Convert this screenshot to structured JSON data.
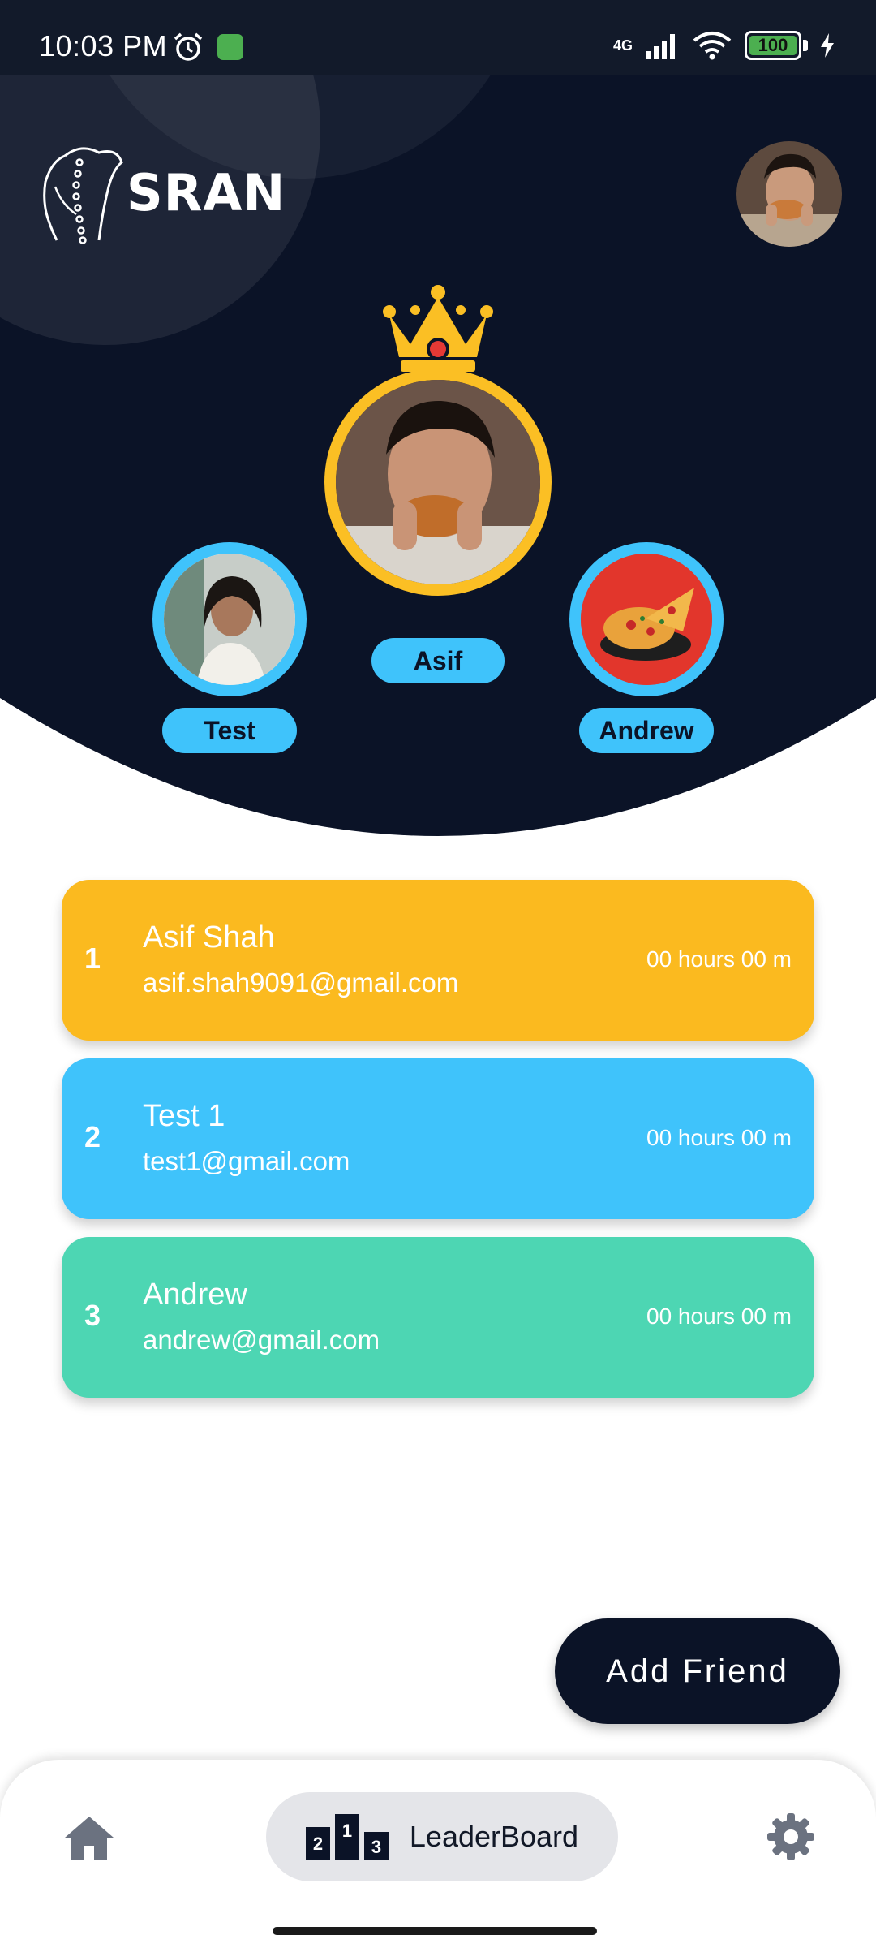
{
  "status_bar": {
    "time": "10:03 PM",
    "network": "4G",
    "battery": "100"
  },
  "app": {
    "logo_text": "SRAN"
  },
  "podium": {
    "first": {
      "name": "Asif"
    },
    "second": {
      "name": "Test"
    },
    "third": {
      "name": "Andrew"
    }
  },
  "leaderboard": [
    {
      "rank": "1",
      "name": "Asif Shah",
      "email": "asif.shah9091@gmail.com",
      "time": "00 hours 00 m",
      "color": "#fbba1f"
    },
    {
      "rank": "2",
      "name": "Test 1",
      "email": "test1@gmail.com",
      "time": "00 hours 00 m",
      "color": "#3fc3fb"
    },
    {
      "rank": "3",
      "name": "Andrew",
      "email": "andrew@gmail.com",
      "time": "00 hours 00 m",
      "color": "#4dd6b3"
    }
  ],
  "add_friend_label": "Add Friend",
  "bottom_nav": {
    "leaderboard_label": "LeaderBoard",
    "podium_digits": [
      "2",
      "1",
      "3"
    ]
  },
  "colors": {
    "navy": "#0b1327",
    "gold": "#fbbf24",
    "sky": "#3fc3fb",
    "mint": "#4dd6b3"
  }
}
